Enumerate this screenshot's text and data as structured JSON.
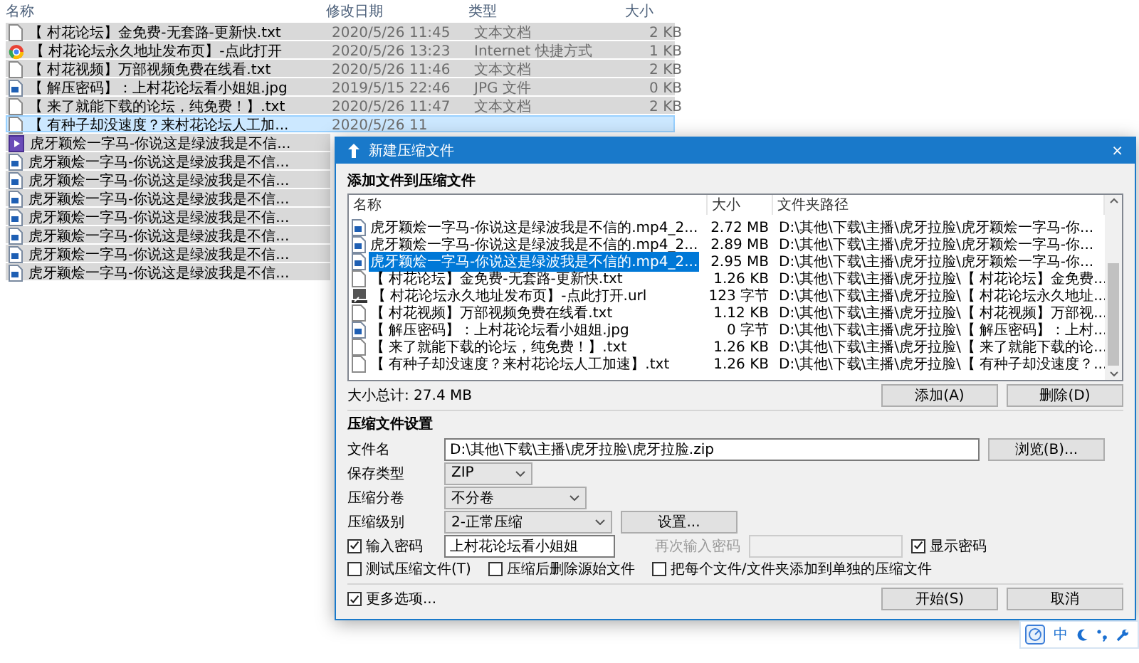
{
  "explorer": {
    "columns": [
      "名称",
      "修改日期",
      "类型",
      "大小"
    ],
    "rows": [
      {
        "name": "【 村花论坛】金免费-无套路-更新快.txt",
        "date": "2020/5/26 11:45",
        "type": "文本文档",
        "size": "2 KB",
        "kind": "text",
        "selected": true,
        "hovered": false
      },
      {
        "name": "【 村花论坛永久地址发布页】-点此打开",
        "date": "2020/5/26 13:23",
        "type": "Internet 快捷方式",
        "size": "1 KB",
        "kind": "link",
        "selected": true,
        "hovered": false
      },
      {
        "name": "【 村花视频】万部视频免费在线看.txt",
        "date": "2020/5/26 11:46",
        "type": "文本文档",
        "size": "2 KB",
        "kind": "text",
        "selected": true,
        "hovered": false
      },
      {
        "name": "【 解压密码】：上村花论坛看小姐姐.jpg",
        "date": "2019/5/15 22:46",
        "type": "JPG 文件",
        "size": "0 KB",
        "kind": "image",
        "selected": true,
        "hovered": false
      },
      {
        "name": "【 来了就能下载的论坛，纯免费！】.txt",
        "date": "2020/5/26 11:47",
        "type": "文本文档",
        "size": "2 KB",
        "kind": "text",
        "selected": true,
        "hovered": false
      },
      {
        "name": "【 有种子却没速度？来村花论坛人工加...",
        "date": "2020/5/26 11",
        "kind": "text",
        "selected": true,
        "hovered": true
      },
      {
        "name": "虎牙颖烩一字马-你说这是绿波我是不信...",
        "kind": "video",
        "selected": true,
        "hovered": false
      },
      {
        "name": "虎牙颖烩一字马-你说这是绿波我是不信...",
        "kind": "image",
        "selected": true,
        "hovered": false
      },
      {
        "name": "虎牙颖烩一字马-你说这是绿波我是不信...",
        "kind": "image",
        "selected": true,
        "hovered": false
      },
      {
        "name": "虎牙颖烩一字马-你说这是绿波我是不信...",
        "kind": "image",
        "selected": true,
        "hovered": false
      },
      {
        "name": "虎牙颖烩一字马-你说这是绿波我是不信...",
        "kind": "image",
        "selected": true,
        "hovered": false
      },
      {
        "name": "虎牙颖烩一字马-你说这是绿波我是不信...",
        "kind": "image",
        "selected": true,
        "hovered": false
      },
      {
        "name": "虎牙颖烩一字马-你说这是绿波我是不信...",
        "kind": "image",
        "selected": true,
        "hovered": false
      },
      {
        "name": "虎牙颖烩一字马-你说这是绿波我是不信...",
        "kind": "image",
        "selected": true,
        "hovered": false
      }
    ]
  },
  "dialog": {
    "title": "新建压缩文件",
    "close": "×",
    "add_heading": "添加文件到压缩文件",
    "columns": [
      "名称",
      "大小",
      "文件夹路径"
    ],
    "files": [
      {
        "name": "虎牙颖烩一字马-你说这是绿波我是不信的.mp4_2...",
        "size": "2.72 MB",
        "path": "D:\\其他\\下载\\主播\\虎牙拉脸\\虎牙颖烩一字马-你...",
        "kind": "image",
        "selected": false
      },
      {
        "name": "虎牙颖烩一字马-你说这是绿波我是不信的.mp4_2...",
        "size": "2.89 MB",
        "path": "D:\\其他\\下载\\主播\\虎牙拉脸\\虎牙颖烩一字马-你...",
        "kind": "image",
        "selected": false
      },
      {
        "name": "虎牙颖烩一字马-你说这是绿波我是不信的.mp4_2...",
        "size": "2.95 MB",
        "path": "D:\\其他\\下载\\主播\\虎牙拉脸\\虎牙颖烩一字马-你...",
        "kind": "image",
        "selected": true
      },
      {
        "name": "【 村花论坛】金免费-无套路-更新快.txt",
        "size": "1.26 KB",
        "path": "D:\\其他\\下载\\主播\\虎牙拉脸\\【 村花论坛】金免费...",
        "kind": "text",
        "selected": false
      },
      {
        "name": "【 村花论坛永久地址发布页】-点此打开.url",
        "size": "123 字节",
        "path": "D:\\其他\\下载\\主播\\虎牙拉脸\\【 村花论坛永久地址...",
        "kind": "shortcut",
        "selected": false
      },
      {
        "name": "【 村花视频】万部视频免费在线看.txt",
        "size": "1.12 KB",
        "path": "D:\\其他\\下载\\主播\\虎牙拉脸\\【 村花视频】万部视...",
        "kind": "text",
        "selected": false
      },
      {
        "name": "【 解压密码】：上村花论坛看小姐姐.jpg",
        "size": "0 字节",
        "path": "D:\\其他\\下载\\主播\\虎牙拉脸\\【 解压密码】：上村...",
        "kind": "image",
        "selected": false
      },
      {
        "name": "【 来了就能下载的论坛，纯免费！】.txt",
        "size": "1.26 KB",
        "path": "D:\\其他\\下载\\主播\\虎牙拉脸\\【 来了就能下载的论...",
        "kind": "text",
        "selected": false
      },
      {
        "name": "【 有种子却没速度？来村花论坛人工加速】.txt",
        "size": "1.26 KB",
        "path": "D:\\其他\\下载\\主播\\虎牙拉脸\\【 有种子却没速度？...",
        "kind": "text",
        "selected": false
      }
    ],
    "total": "大小总计: 27.4 MB",
    "list_buttons": [
      "添加(A)",
      "删除(D)"
    ],
    "settings_heading": "压缩文件设置",
    "filename": {
      "label": "文件名",
      "value": "D:\\其他\\下载\\主播\\虎牙拉脸\\虎牙拉脸.zip",
      "button": "浏览(B)..."
    },
    "format": {
      "label": "保存类型",
      "value": "ZIP"
    },
    "split": {
      "label": "压缩分卷",
      "value": "不分卷"
    },
    "level": {
      "label": "压缩级别",
      "value": "2-正常压缩",
      "button": "设置..."
    },
    "password": {
      "label": "输入密码",
      "checked": true,
      "value": "上村花论坛看小姐姐"
    },
    "confirm": {
      "label": "再次输入密码",
      "disabled": true
    },
    "show_password": {
      "label": "显示密码",
      "checked": true
    },
    "options": [
      {
        "label": "测试压缩文件(T)",
        "checked": false
      },
      {
        "label": "压缩后删除源始文件",
        "checked": false
      },
      {
        "label": "把每个文件/文件夹添加到单独的压缩文件",
        "checked": false
      }
    ],
    "more": {
      "label": "更多选项...",
      "checked": true
    },
    "buttons": [
      "开始(S)",
      "取消"
    ]
  },
  "tray": {
    "mode": "中"
  }
}
